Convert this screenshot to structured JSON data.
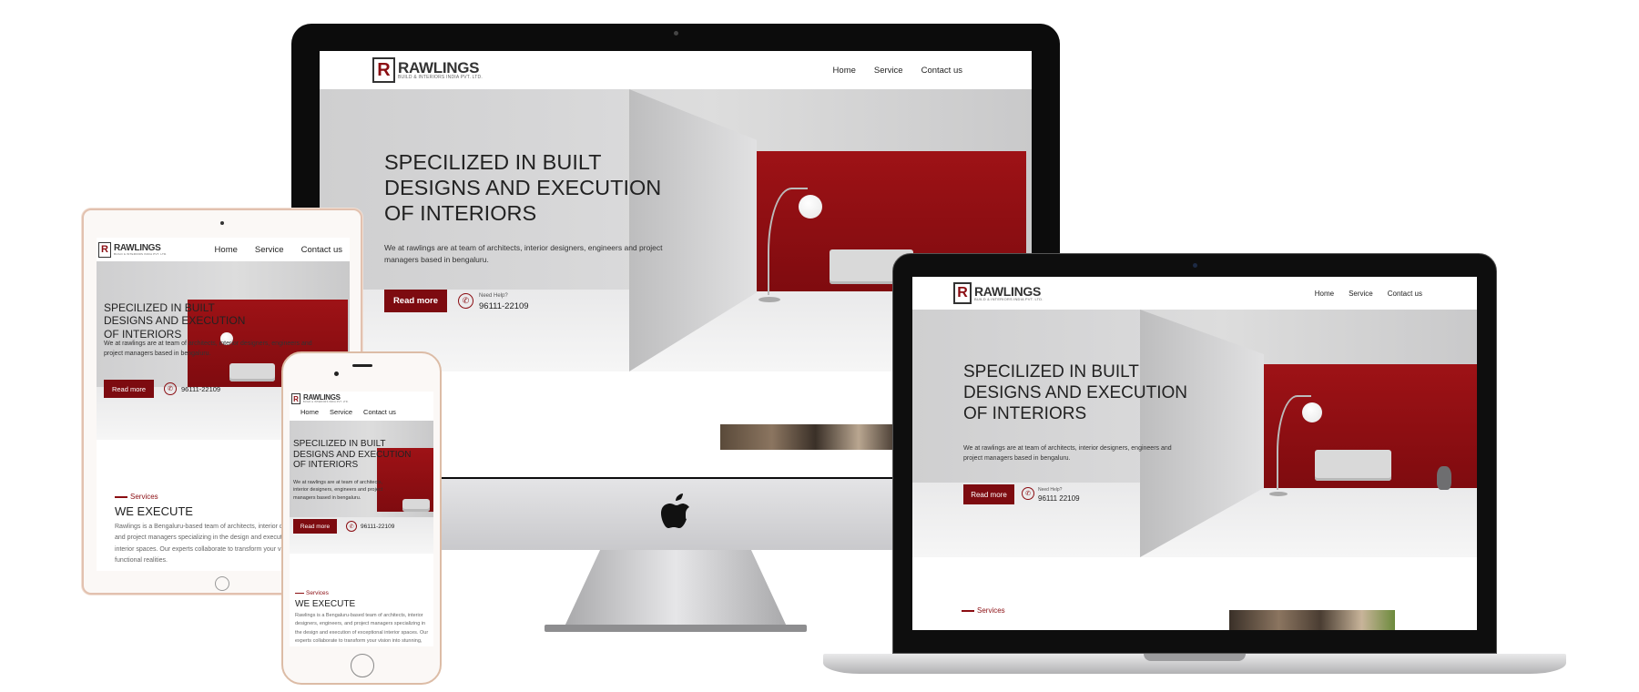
{
  "brand": {
    "name": "RAWLINGS",
    "tagline": "BUILD & INTERIORS INDIA PVT. LTD.",
    "color": "#8b0d12"
  },
  "nav": {
    "home": "Home",
    "service": "Service",
    "contact": "Contact us"
  },
  "hero": {
    "title_l1": "SPECILIZED IN BUILT",
    "title_l2": "DESIGNS AND EXECUTION",
    "title_l3": "OF INTERIORS",
    "description": "We at rawlings are at team of architects, interior designers, engineers and project managers based in bengaluru.",
    "button": "Read more",
    "help_label": "Need Help?",
    "phone": "96111-22109",
    "phone_laptop": "96111 22109"
  },
  "services": {
    "label": "Services",
    "heading": "WE EXECUTE",
    "body": "Rawlings is a Bengaluru-based team of architects, interior designers, engineers, and project managers specializing in the design and execution of exceptional interior spaces. Our experts collaborate to transform your vision into stunning, functional realities."
  },
  "colors": {
    "accent": "#7d0b10",
    "wall_red": "#9e1216",
    "device_black": "#111111",
    "tablet_frame": "#e8cfc0",
    "phone_frame": "#e2c6b0"
  }
}
